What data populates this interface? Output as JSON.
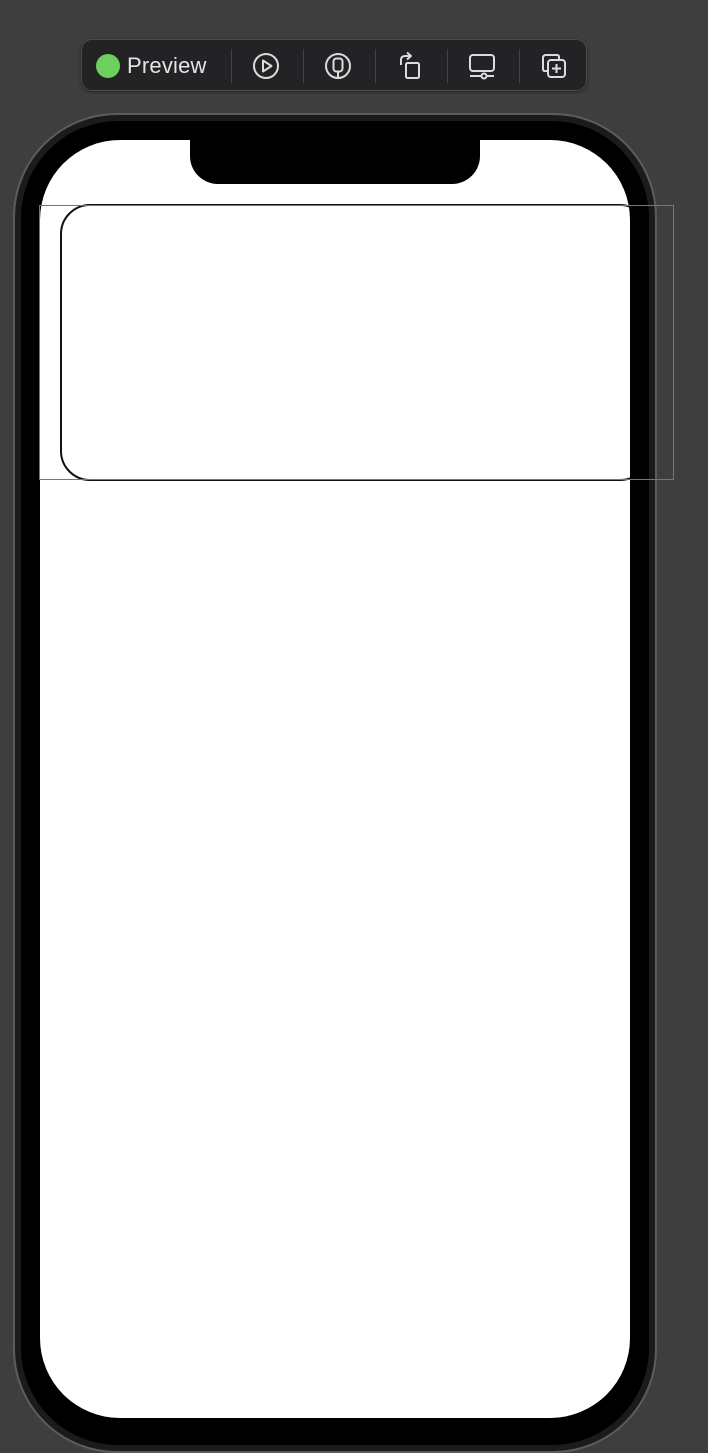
{
  "toolbar": {
    "status_color": "#6bd05d",
    "preview_label": "Preview",
    "buttons": [
      {
        "name": "live-preview-button",
        "icon": "play-circle-icon"
      },
      {
        "name": "on-device-button",
        "icon": "device-icon"
      },
      {
        "name": "rotate-device-button",
        "icon": "rotate-icon"
      },
      {
        "name": "device-settings-button",
        "icon": "display-settings-icon"
      },
      {
        "name": "duplicate-preview-button",
        "icon": "duplicate-plus-icon"
      }
    ]
  },
  "canvas": {
    "background": "#3e3e3e",
    "device_frame": "iPhone",
    "screen_background": "#ffffff",
    "selection_color": "#3f7bf0"
  }
}
